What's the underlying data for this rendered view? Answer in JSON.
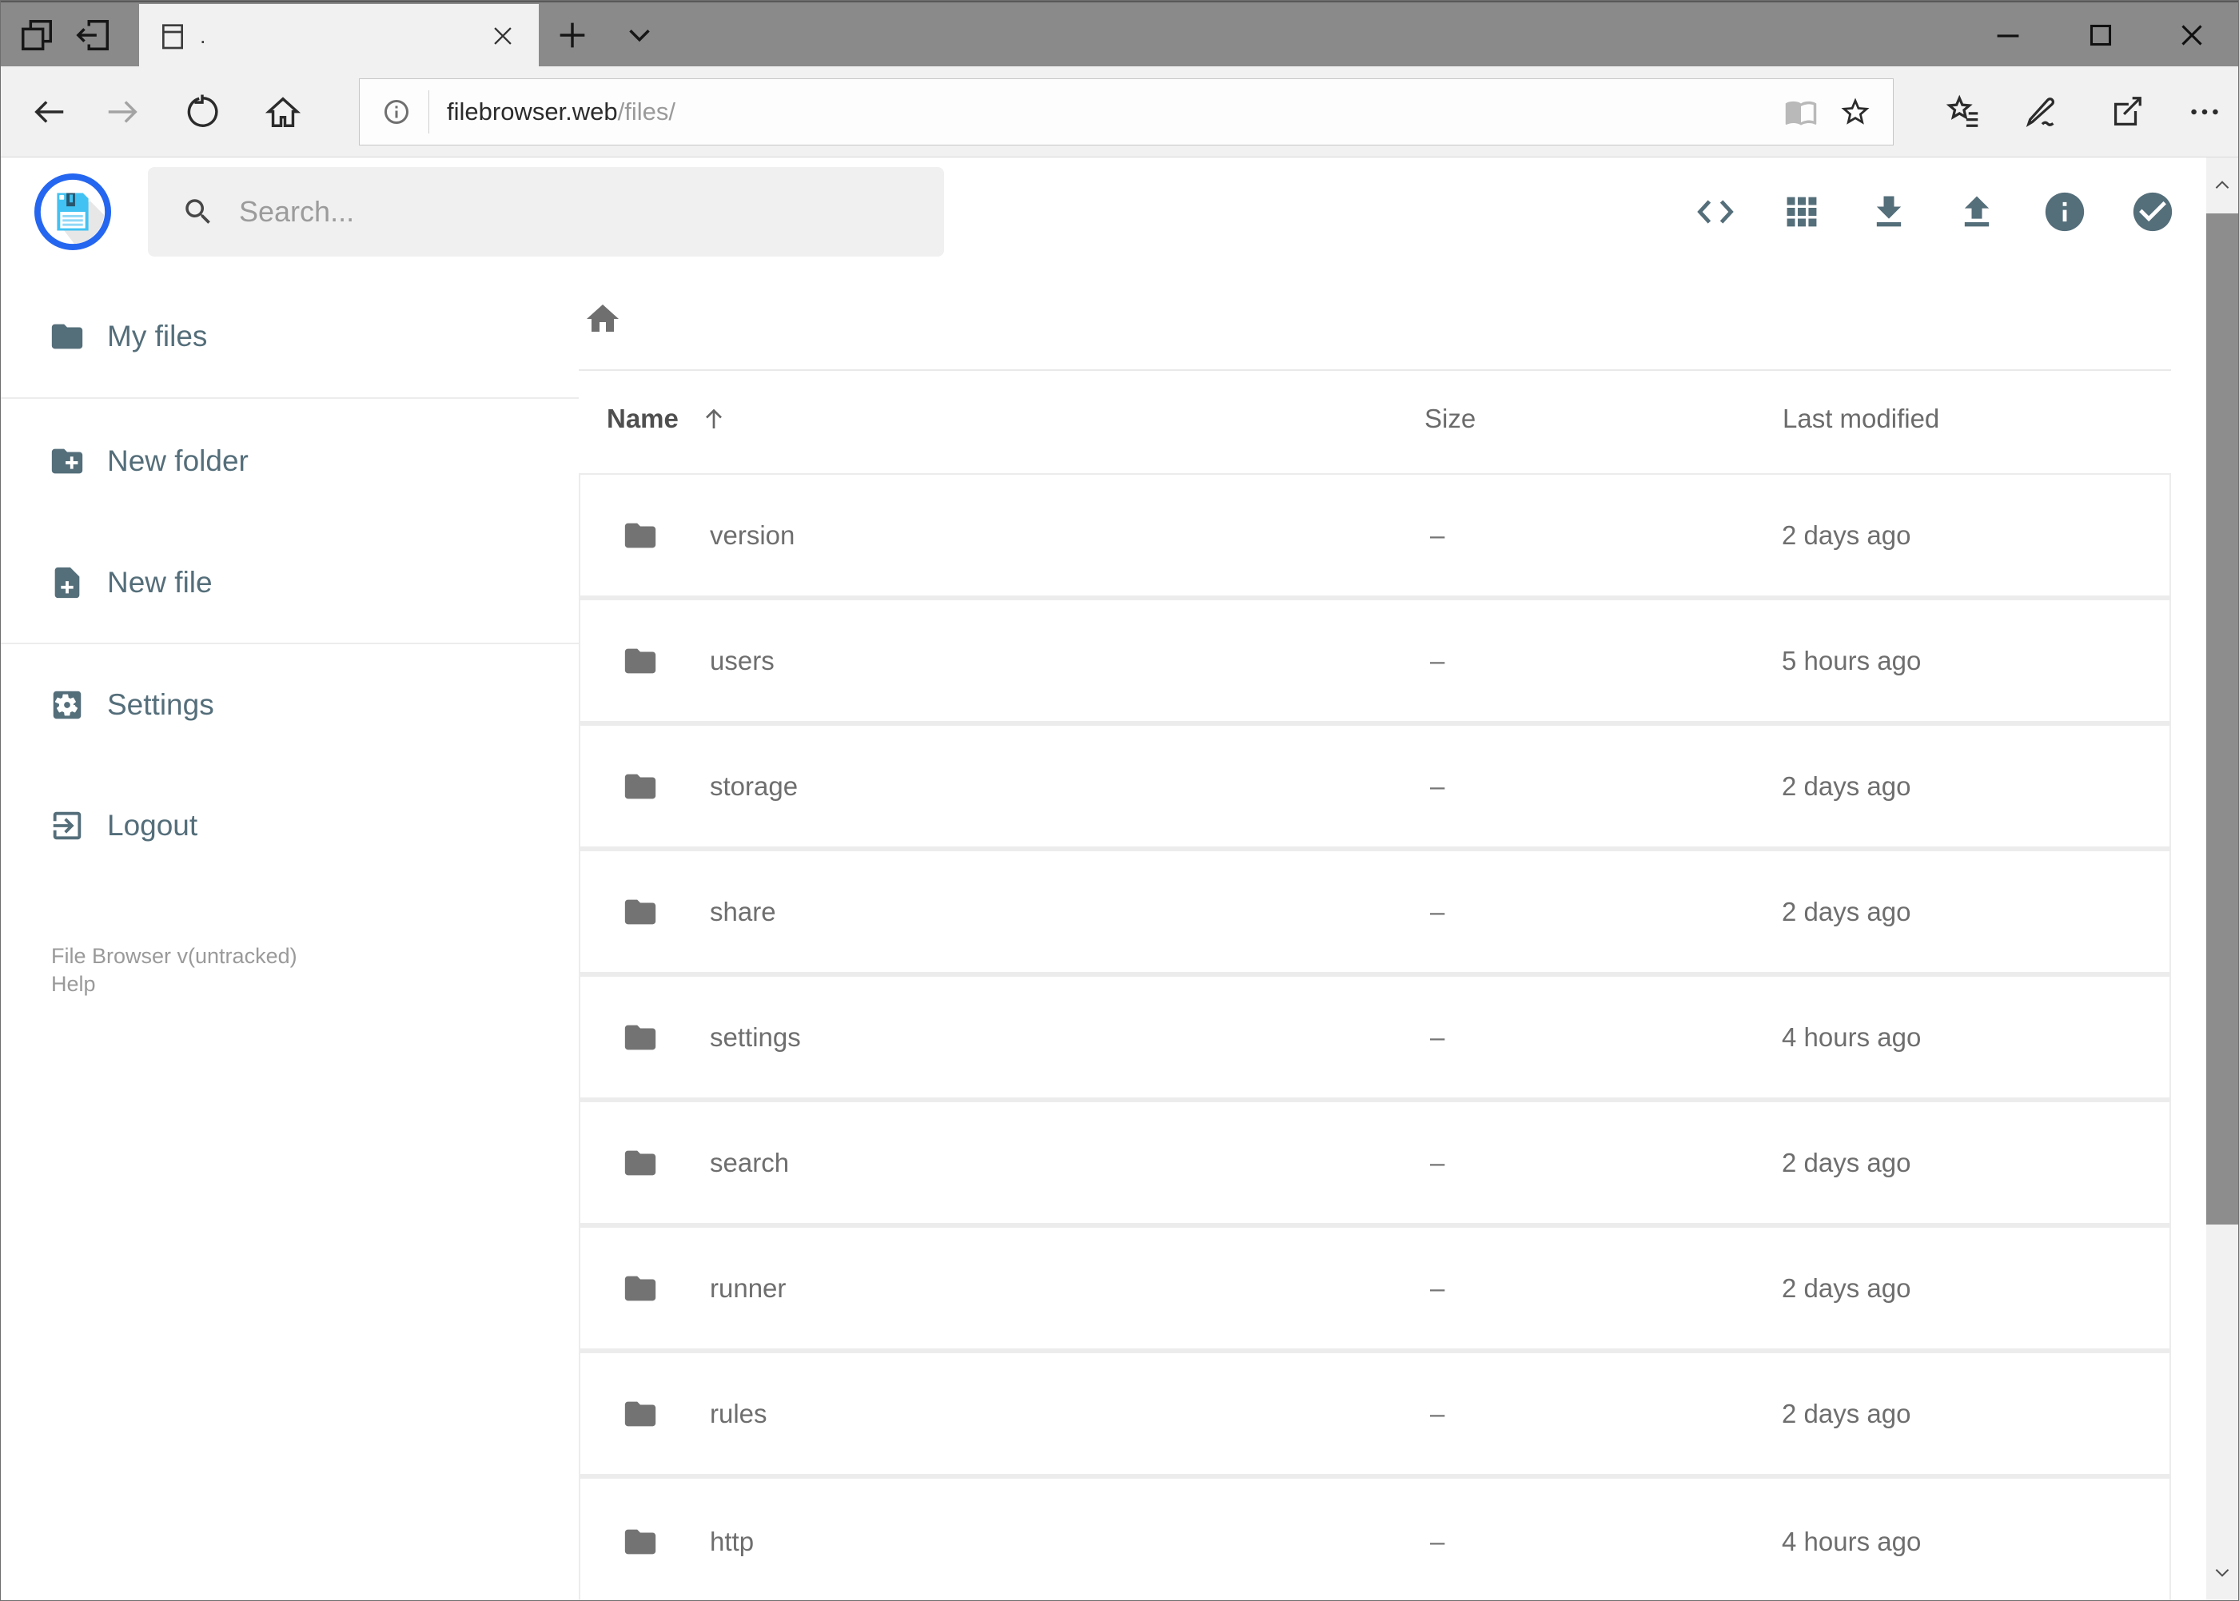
{
  "browser": {
    "tab_title": ".",
    "url_host": "filebrowser.web",
    "url_path": "/files/"
  },
  "header": {
    "search_placeholder": "Search..."
  },
  "icons": {
    "toolbar": [
      "code-view",
      "grid-view",
      "download",
      "upload",
      "info",
      "select"
    ],
    "logo": "floppy-disk",
    "colors": {
      "accent": "#546e7a",
      "logo_ring": "#2566f0",
      "logo_disk": "#41c2f2",
      "folder": "#737373"
    }
  },
  "sidebar": {
    "items": [
      {
        "label": "My files",
        "icon": "folder"
      },
      {
        "label": "New folder",
        "icon": "folder-plus"
      },
      {
        "label": "New file",
        "icon": "file-plus"
      },
      {
        "label": "Settings",
        "icon": "gear"
      },
      {
        "label": "Logout",
        "icon": "logout"
      }
    ],
    "footer_version": "File Browser v(untracked)",
    "footer_help": "Help"
  },
  "files": {
    "columns": {
      "name": "Name",
      "size": "Size",
      "modified": "Last modified"
    },
    "sort": {
      "column": "Name",
      "direction": "ascending"
    },
    "rows": [
      {
        "name": "version",
        "size": "–",
        "modified": "2 days ago"
      },
      {
        "name": "users",
        "size": "–",
        "modified": "5 hours ago"
      },
      {
        "name": "storage",
        "size": "–",
        "modified": "2 days ago"
      },
      {
        "name": "share",
        "size": "–",
        "modified": "2 days ago"
      },
      {
        "name": "settings",
        "size": "–",
        "modified": "4 hours ago"
      },
      {
        "name": "search",
        "size": "–",
        "modified": "2 days ago"
      },
      {
        "name": "runner",
        "size": "–",
        "modified": "2 days ago"
      },
      {
        "name": "rules",
        "size": "–",
        "modified": "2 days ago"
      },
      {
        "name": "http",
        "size": "–",
        "modified": "4 hours ago"
      }
    ]
  }
}
